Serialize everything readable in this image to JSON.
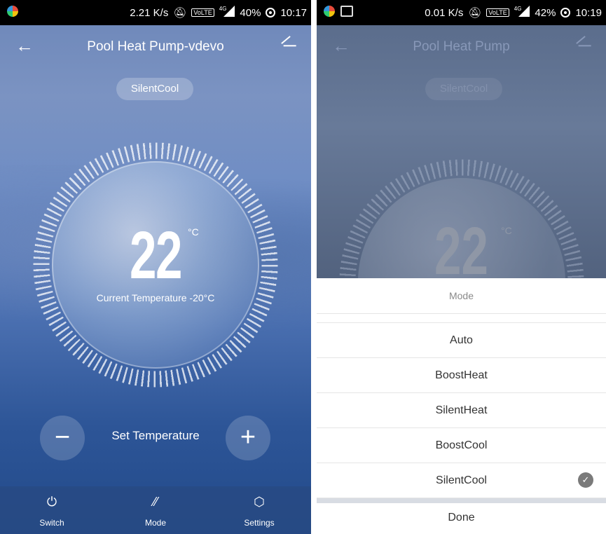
{
  "left_status": {
    "speed": "2.21 K/s",
    "volte": "VoLTE",
    "network": "4G",
    "battery": "40%",
    "time": "10:17"
  },
  "right_status": {
    "speed": "0.01 K/s",
    "volte": "VoLTE",
    "network": "4G",
    "battery": "42%",
    "time": "10:19"
  },
  "left": {
    "header": {
      "title": "Pool Heat Pump-vdevo",
      "back_icon": "arrow-left-icon",
      "edit_icon": "pencil-icon"
    },
    "mode_pill": "SilentCool",
    "dial": {
      "temperature": "22",
      "unit": "°C",
      "current_label": "Current Temperature -20°C"
    },
    "controls": {
      "minus": "−",
      "plus": "+",
      "label": "Set Temperature"
    },
    "nav": [
      {
        "label": "Switch",
        "icon": "power-icon",
        "glyph": "⏻"
      },
      {
        "label": "Mode",
        "icon": "mode-icon",
        "glyph": "⁄⁄"
      },
      {
        "label": "Settings",
        "icon": "settings-cube-icon",
        "glyph": "⬡"
      }
    ]
  },
  "right": {
    "header": {
      "title": "Pool Heat Pump"
    },
    "mode_pill": "SilentCool",
    "dial": {
      "temperature": "22",
      "unit": "°C"
    },
    "sheet": {
      "title": "Mode",
      "options": [
        "Auto",
        "BoostHeat",
        "SilentHeat",
        "BoostCool",
        "SilentCool"
      ],
      "selected": "SilentCool",
      "done": "Done"
    }
  },
  "colors": {
    "accent_blue": "#3a63a6",
    "check_gray": "#7a7a7a"
  }
}
